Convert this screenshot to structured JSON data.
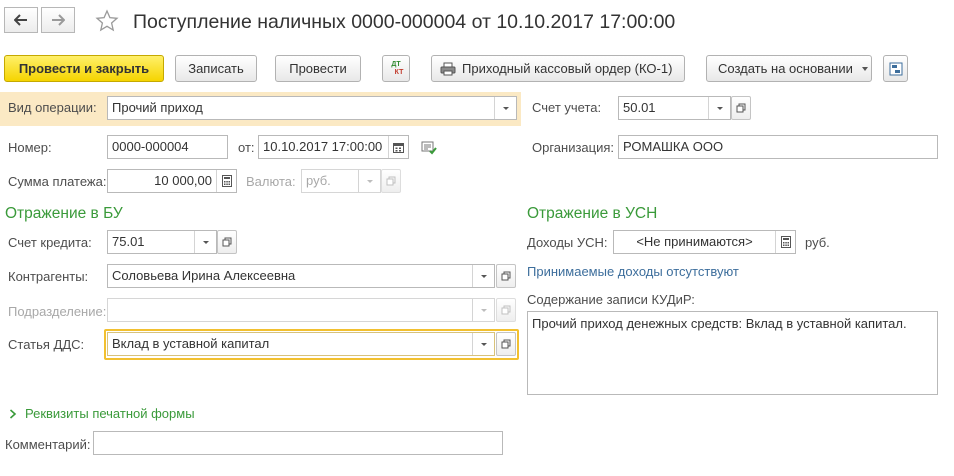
{
  "window": {
    "title": "Поступление наличных 0000-000004 от 10.10.2017 17:00:00"
  },
  "toolbar": {
    "post_and_close": "Провести и закрыть",
    "save": "Записать",
    "post": "Провести",
    "dt_kt_top": "ДТ",
    "dt_kt_bottom": "КТ",
    "print_order": "Приходный кассовый ордер (КО-1)",
    "create_based": "Создать на основании"
  },
  "header": {
    "operation_label": "Вид операции:",
    "operation_value": "Прочий приход",
    "account_label": "Счет учета:",
    "account_value": "50.01",
    "number_label": "Номер:",
    "number_value": "0000-000004",
    "date_label": "от:",
    "date_value": "10.10.2017 17:00:00",
    "org_label": "Организация:",
    "org_value": "РОМАШКА ООО",
    "amount_label": "Сумма платежа:",
    "amount_value": "10 000,00",
    "currency_label": "Валюта:",
    "currency_value": "руб."
  },
  "bu": {
    "section_title": "Отражение в БУ",
    "credit_label": "Счет кредита:",
    "credit_value": "75.01",
    "counterparty_label": "Контрагенты:",
    "counterparty_value": "Соловьева Ирина Алексеевна",
    "department_label": "Подразделение:",
    "department_value": "",
    "dds_label": "Статья ДДС:",
    "dds_value": "Вклад в уставной капитал"
  },
  "usn": {
    "section_title": "Отражение в УСН",
    "income_label": "Доходы УСН:",
    "income_value": "<Не принимаются>",
    "income_unit": "руб.",
    "accepted_link": "Принимаемые доходы отсутствуют",
    "kudir_label": "Содержание записи КУДиР:",
    "kudir_value": "Прочий приход денежных средств: Вклад в уставной капитал."
  },
  "print_form": {
    "label": "Реквизиты печатной формы"
  },
  "comment": {
    "label": "Комментарий:",
    "value": ""
  },
  "colors": {
    "primary_button": "#f5d400",
    "section_title": "#3a9a3a",
    "link": "#3d6e9c",
    "highlight_row": "#fbe9c4",
    "focus_ring": "#f2c02f"
  }
}
